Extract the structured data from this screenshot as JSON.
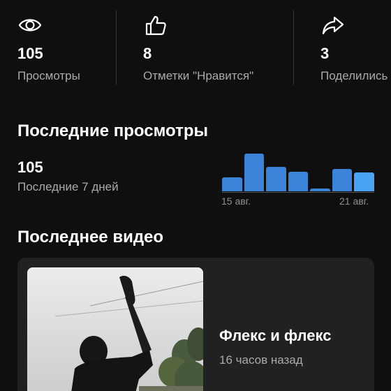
{
  "stats": {
    "views": {
      "icon": "eye-icon",
      "value": "105",
      "label": "Просмотры"
    },
    "likes": {
      "icon": "thumbs-up-icon",
      "value": "8",
      "label": "Отметки \"Нравится\""
    },
    "shares": {
      "icon": "share-arrow-icon",
      "value": "3",
      "label": "Поделились"
    }
  },
  "recent_views": {
    "title": "Последние просмотры",
    "count": "105",
    "period": "Последние 7 дней",
    "chart_data": {
      "type": "bar",
      "categories": [
        "15 авг.",
        "",
        "",
        "",
        "",
        "",
        "21 авг."
      ],
      "values": [
        18,
        48,
        31,
        25,
        4,
        29,
        24
      ],
      "highlight_index": 6,
      "ylim": [
        0,
        50
      ],
      "xlabel": "",
      "ylabel": "",
      "tick_labels": [
        "15 авг.",
        "21 авг."
      ],
      "colors": {
        "bar": "#3b83d9",
        "highlight": "#4aa3f5"
      }
    }
  },
  "latest_video": {
    "section_title": "Последнее видео",
    "title": "Флекс и флекс",
    "age": "16 часов назад"
  },
  "colors": {
    "background": "#0f0f0f",
    "card": "#212121",
    "secondary_text": "#aaaaaa",
    "accent": "#3b83d9"
  }
}
